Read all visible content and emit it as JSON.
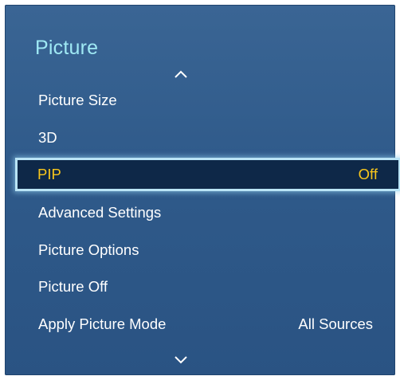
{
  "menu": {
    "title": "Picture",
    "items": [
      {
        "label": "Picture Size",
        "value": ""
      },
      {
        "label": "3D",
        "value": ""
      },
      {
        "label": "PIP",
        "value": "Off",
        "selected": true
      },
      {
        "label": "Advanced Settings",
        "value": ""
      },
      {
        "label": "Picture Options",
        "value": ""
      },
      {
        "label": "Picture Off",
        "value": ""
      },
      {
        "label": "Apply Picture Mode",
        "value": "All Sources"
      }
    ]
  },
  "colors": {
    "panel_background": "#2f5a8a",
    "title_text": "#9fe9f4",
    "selected_text": "#f8c61c",
    "selected_border": "#b9e4f6"
  },
  "icons": [
    "chevron-up-icon",
    "chevron-down-icon"
  ]
}
